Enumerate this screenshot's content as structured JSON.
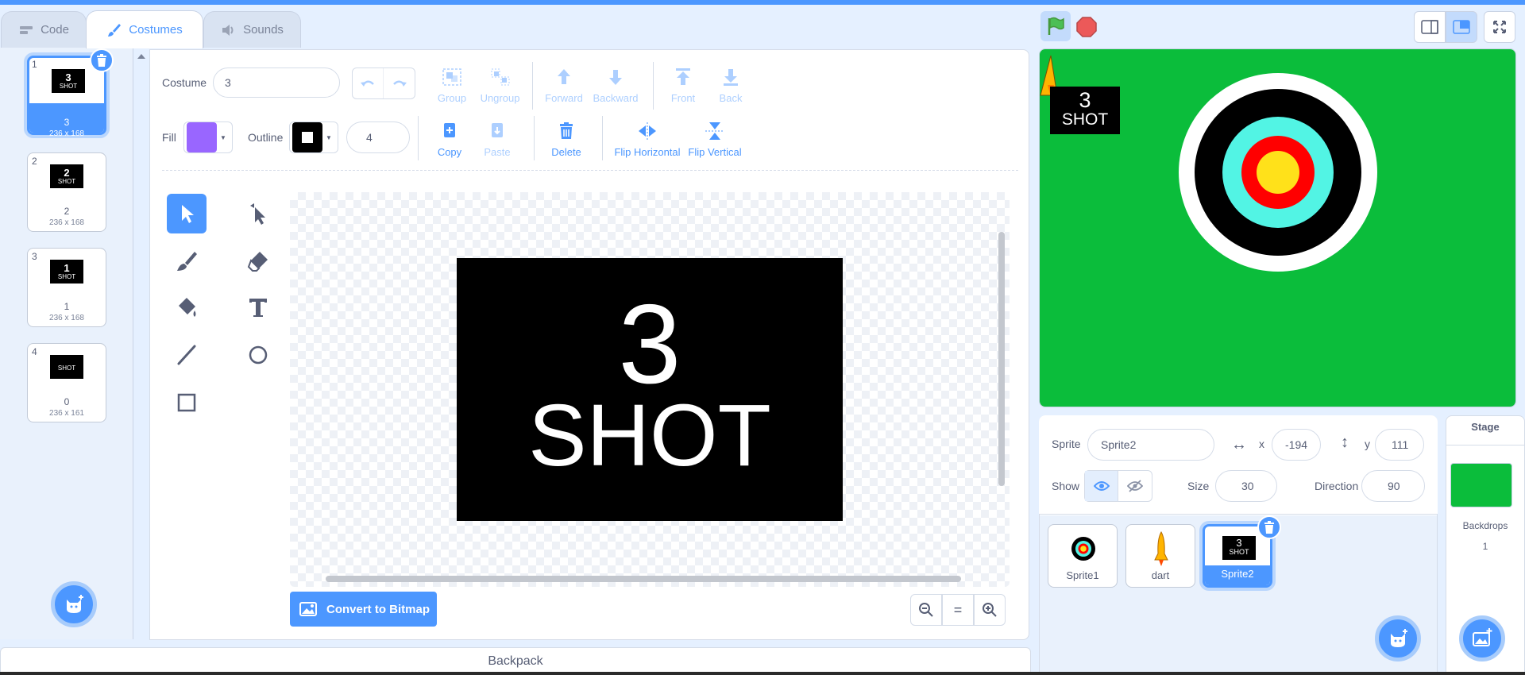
{
  "tabs": {
    "code": "Code",
    "costumes": "Costumes",
    "sounds": "Sounds"
  },
  "costumes": [
    {
      "number": "1",
      "art_top": "3",
      "art_bottom": "SHOT",
      "name": "3",
      "size": "236 x 168",
      "selected": true
    },
    {
      "number": "2",
      "art_top": "2",
      "art_bottom": "SHOT",
      "name": "2",
      "size": "236 x 168"
    },
    {
      "number": "3",
      "art_top": "1",
      "art_bottom": "SHOT",
      "name": "1",
      "size": "236 x 168"
    },
    {
      "number": "4",
      "art_top": "",
      "art_bottom": "SHOT",
      "name": "0",
      "size": "236 x 161"
    }
  ],
  "editor": {
    "costume_label": "Costume",
    "costume_name": "3",
    "fill_label": "Fill",
    "fill_color": "#9966ff",
    "outline_label": "Outline",
    "outline_color": "#000000",
    "outline_width": "4",
    "group": "Group",
    "ungroup": "Ungroup",
    "forward": "Forward",
    "backward": "Backward",
    "front": "Front",
    "back": "Back",
    "copy": "Copy",
    "paste": "Paste",
    "delete": "Delete",
    "flip_horizontal": "Flip Horizontal",
    "flip_vertical": "Flip Vertical",
    "art_top": "3",
    "art_bottom": "SHOT",
    "convert": "Convert to Bitmap",
    "zoom_reset": "="
  },
  "backpack": "Backpack",
  "stage": {
    "background": "#0bbd3b",
    "badge_top": "3",
    "badge_bottom": "SHOT"
  },
  "sprite_info": {
    "sprite_label": "Sprite",
    "sprite_name": "Sprite2",
    "x_label": "x",
    "x": "-194",
    "y_label": "y",
    "y": "111",
    "show_label": "Show",
    "size_label": "Size",
    "size": "30",
    "direction_label": "Direction",
    "direction": "90"
  },
  "sprites": [
    {
      "name": "Sprite1"
    },
    {
      "name": "dart"
    },
    {
      "name": "Sprite2",
      "selected": true,
      "art_top": "3",
      "art_bottom": "SHOT"
    }
  ],
  "stage_target": {
    "title": "Stage",
    "backdrops_label": "Backdrops",
    "backdrops_count": "1"
  },
  "colors": {
    "accent": "#4c97ff",
    "stage_green": "#0bbd3b"
  }
}
